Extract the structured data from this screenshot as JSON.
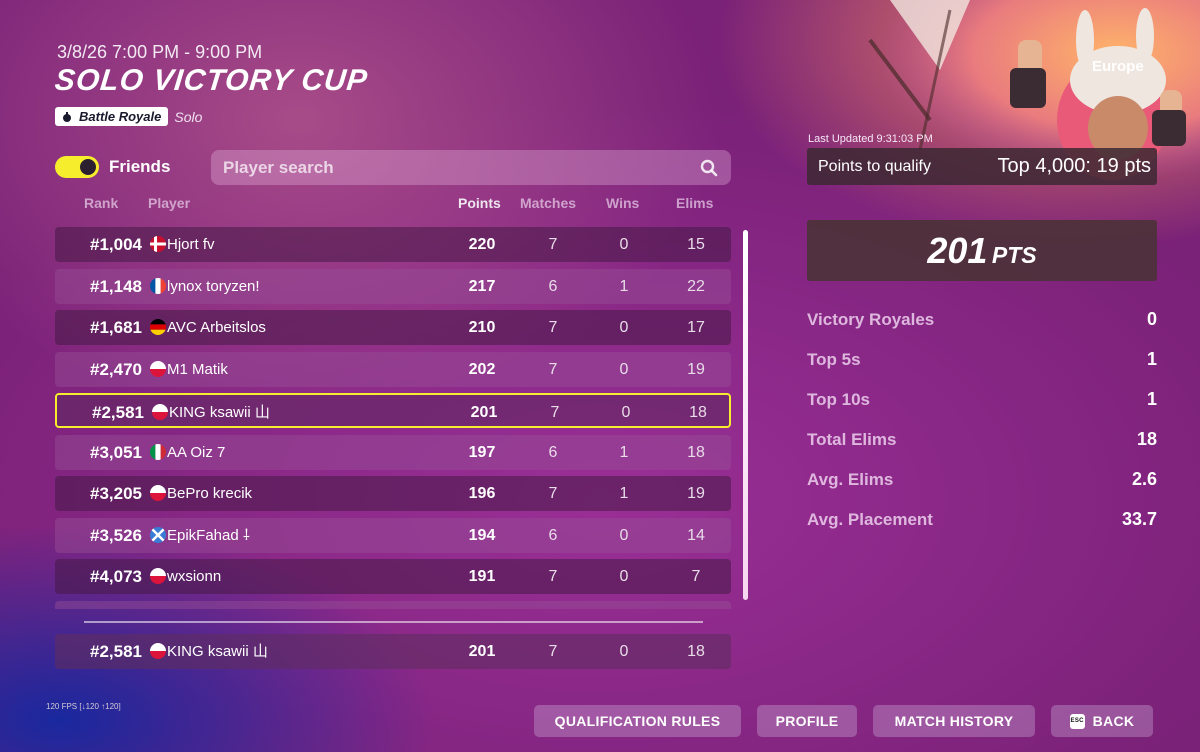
{
  "header": {
    "date_range": "3/8/26 7:00 PM - 9:00 PM",
    "title": "SOLO VICTORY CUP",
    "mode_label": "Battle Royale",
    "mode_sub": "Solo"
  },
  "friends_label": "Friends",
  "friends_toggle_on": true,
  "search": {
    "placeholder": "Player search",
    "value": ""
  },
  "columns": {
    "rank": "Rank",
    "player": "Player",
    "points": "Points",
    "matches": "Matches",
    "wins": "Wins",
    "elims": "Elims"
  },
  "rows": [
    {
      "rank": "#1,004",
      "flag": "denmark",
      "player": "Hjort fv",
      "points": "220",
      "matches": "7",
      "wins": "0",
      "elims": "15"
    },
    {
      "rank": "#1,148",
      "flag": "france",
      "player": "lynox toryzen!",
      "points": "217",
      "matches": "6",
      "wins": "1",
      "elims": "22"
    },
    {
      "rank": "#1,681",
      "flag": "germany",
      "player": "AVC Arbeitslos",
      "points": "210",
      "matches": "7",
      "wins": "0",
      "elims": "17"
    },
    {
      "rank": "#2,470",
      "flag": "poland",
      "player": "M1 Matik",
      "points": "202",
      "matches": "7",
      "wins": "0",
      "elims": "19"
    },
    {
      "rank": "#2,581",
      "flag": "poland",
      "player": "KING ksawii 山",
      "points": "201",
      "matches": "7",
      "wins": "0",
      "elims": "18",
      "highlight": true
    },
    {
      "rank": "#3,051",
      "flag": "italy",
      "player": "AA Oiz 7",
      "points": "197",
      "matches": "6",
      "wins": "1",
      "elims": "18"
    },
    {
      "rank": "#3,205",
      "flag": "poland",
      "player": "BePro krecik",
      "points": "196",
      "matches": "7",
      "wins": "1",
      "elims": "19"
    },
    {
      "rank": "#3,526",
      "flag": "scotland",
      "player": "EpikFahad ⸸",
      "points": "194",
      "matches": "6",
      "wins": "0",
      "elims": "14"
    },
    {
      "rank": "#4,073",
      "flag": "poland",
      "player": "wxsionn",
      "points": "191",
      "matches": "7",
      "wins": "0",
      "elims": "7"
    }
  ],
  "self_row": {
    "rank": "#2,581",
    "flag": "poland",
    "player": "KING ksawii 山",
    "points": "201",
    "matches": "7",
    "wins": "0",
    "elims": "18"
  },
  "panel": {
    "region": "Europe",
    "last_updated": "Last Updated 9:31:03 PM",
    "qualify_label": "Points to qualify",
    "qualify_value": "Top 4,000: 19 pts",
    "total_points": "201",
    "points_unit": "PTS",
    "stats": [
      {
        "label": "Victory Royales",
        "value": "0"
      },
      {
        "label": "Top 5s",
        "value": "1"
      },
      {
        "label": "Top 10s",
        "value": "1"
      },
      {
        "label": "Total Elims",
        "value": "18"
      },
      {
        "label": "Avg. Elims",
        "value": "2.6"
      },
      {
        "label": "Avg. Placement",
        "value": "33.7"
      }
    ]
  },
  "footer": {
    "fps": "120 FPS [↓120 ↑120]",
    "buttons": {
      "rules": "QUALIFICATION RULES",
      "profile": "PROFILE",
      "history": "MATCH HISTORY",
      "back": "BACK",
      "back_key": "ESC"
    }
  },
  "colors": {
    "highlight": "#f6ee2c",
    "bg": "#8a2a88",
    "row_dark": "#461946",
    "row_light": "#965096"
  }
}
